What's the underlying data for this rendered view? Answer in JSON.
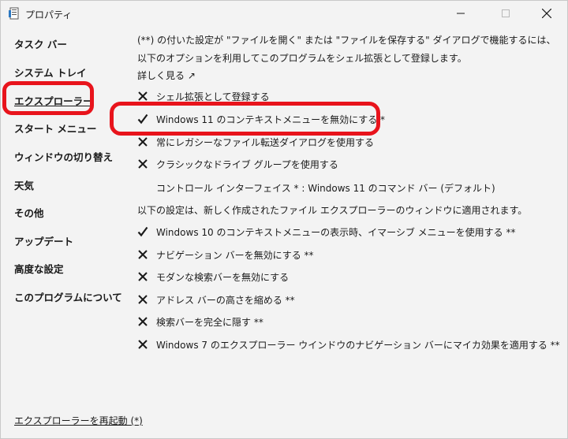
{
  "window": {
    "title": "プロパティ",
    "icon": "properties-app-icon",
    "controls": {
      "minimize": "minimize-icon",
      "maximize": "maximize-icon",
      "close": "close-icon"
    }
  },
  "sidebar": {
    "items": [
      {
        "label": "タスク バー",
        "active": false
      },
      {
        "label": "システム トレイ",
        "active": false
      },
      {
        "label": "エクスプローラー",
        "active": true
      },
      {
        "label": "スタート メニュー",
        "active": false
      },
      {
        "label": "ウィンドウの切り替え",
        "active": false
      },
      {
        "label": "天気",
        "active": false
      },
      {
        "label": "その他",
        "active": false
      },
      {
        "label": "アップデート",
        "active": false
      },
      {
        "label": "高度な設定",
        "active": false
      },
      {
        "label": "このプログラムについて",
        "active": false
      }
    ],
    "restart_link": "エクスプローラーを再起動 (*)"
  },
  "content": {
    "intro_line1": "(**) の付いた設定が \"ファイルを開く\" または \"ファイルを保存する\" ダイアログで機能するには、",
    "intro_line2": "以下のオプションを利用してこのプログラムをシェル拡張として登録します。",
    "learn_more": "詳しく見る ↗",
    "options_top": [
      {
        "label": "シェル拡張として登録する",
        "state": "off"
      },
      {
        "label": "Windows 11 のコンテキストメニューを無効にする *",
        "state": "on"
      },
      {
        "label": "常にレガシーなファイル転送ダイアログを使用する",
        "state": "off"
      },
      {
        "label": "クラシックなドライブ グループを使用する",
        "state": "off"
      }
    ],
    "interface_line": "コントロール インターフェイス * : Windows 11 のコマンド バー (デフォルト)",
    "section_note": "以下の設定は、新しく作成されたファイル エクスプローラーのウィンドウに適用されます。",
    "options_bottom": [
      {
        "label": "Windows 10 のコンテキストメニューの表示時、イマーシブ メニューを使用する **",
        "state": "on"
      },
      {
        "label": "ナビゲーション バーを無効にする **",
        "state": "off"
      },
      {
        "label": "モダンな検索バーを無効にする",
        "state": "off"
      },
      {
        "label": "アドレス バーの高さを縮める **",
        "state": "off"
      },
      {
        "label": "検索バーを完全に隠す **",
        "state": "off"
      },
      {
        "label": "Windows 7 のエクスプローラー ウインドウのナビゲーション バーにマイカ効果を適用する **",
        "state": "off"
      }
    ]
  },
  "colors": {
    "highlight": "#e8141c",
    "background": "#f3f3f3",
    "text": "#1a1a1a"
  }
}
